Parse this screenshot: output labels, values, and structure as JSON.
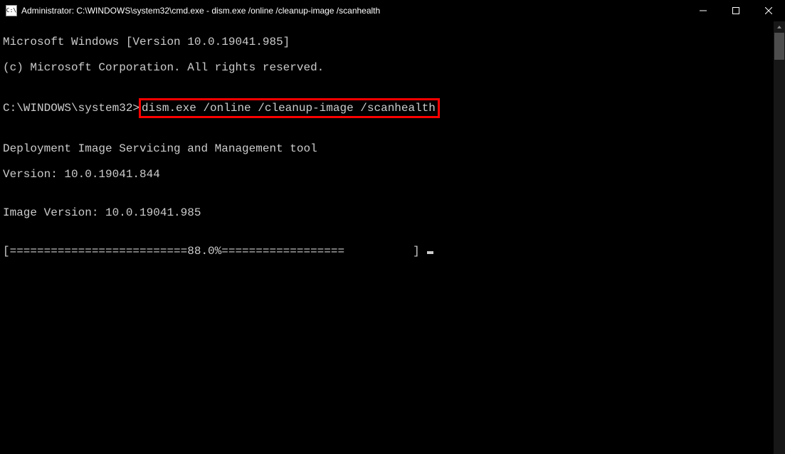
{
  "titlebar": {
    "icon_text": "C:\\",
    "title": "Administrator: C:\\WINDOWS\\system32\\cmd.exe - dism.exe  /online /cleanup-image /scanhealth"
  },
  "terminal": {
    "line1": "Microsoft Windows [Version 10.0.19041.985]",
    "line2": "(c) Microsoft Corporation. All rights reserved.",
    "blank1": "",
    "prompt_prefix": "C:\\WINDOWS\\system32>",
    "command": "dism.exe /online /cleanup-image /scanhealth",
    "blank2": "",
    "tool_line": "Deployment Image Servicing and Management tool",
    "version_line": "Version: 10.0.19041.844",
    "blank3": "",
    "image_version": "Image Version: 10.0.19041.985",
    "blank4": "",
    "progress": "[==========================88.0%==================          ] "
  }
}
